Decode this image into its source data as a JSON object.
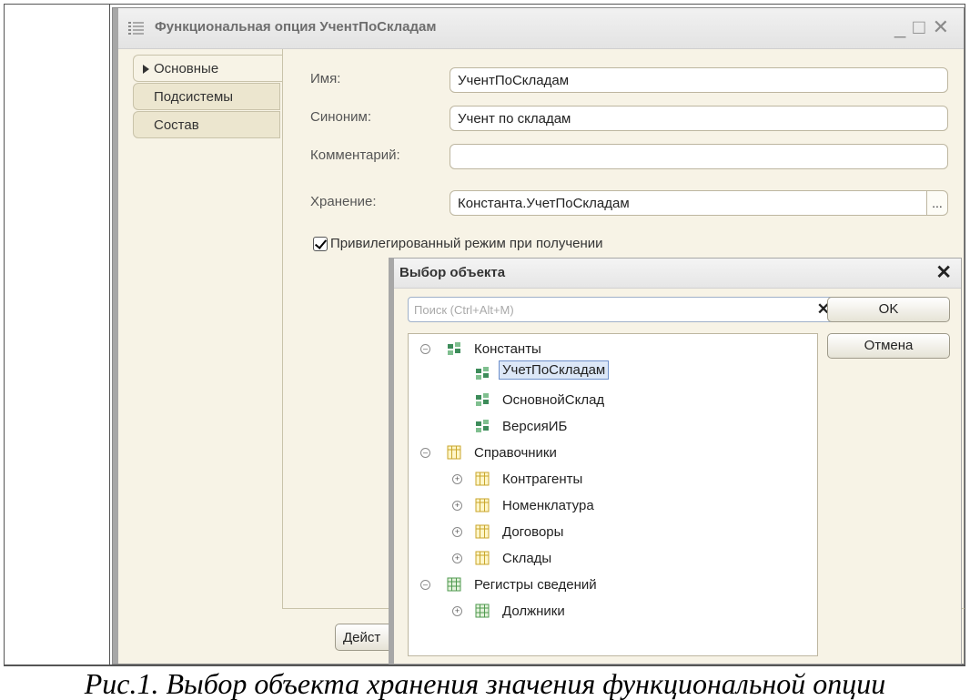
{
  "window": {
    "title": "Функциональная опция УчентПоСкладам",
    "controls": [
      "_",
      "□",
      "✕"
    ]
  },
  "tabs": [
    {
      "label": "Основные",
      "active": true
    },
    {
      "label": "Подсистемы",
      "active": false
    },
    {
      "label": "Состав",
      "active": false
    }
  ],
  "form": {
    "name_label": "Имя:",
    "name_value": "УчентПоСкладам",
    "synonym_label": "Синоним:",
    "synonym_value": "Учент по складам",
    "comment_label": "Комментарий:",
    "comment_value": "",
    "storage_label": "Хранение:",
    "storage_value": "Константа.УчетПоСкладам",
    "storage_button": "...",
    "privileged_label": "Привилегированный режим при получении",
    "privileged_checked": true,
    "actions_button": "Дейст"
  },
  "dialog": {
    "title": "Выбор объекта",
    "close": "✕",
    "search_placeholder": "Поиск (Ctrl+Alt+M)",
    "search_clear": "✕",
    "ok_label": "OK",
    "cancel_label": "Отмена",
    "tree": [
      {
        "label": "Константы",
        "level": 0,
        "expander": "minus",
        "icon": "constant-icon"
      },
      {
        "label": "УчетПоСкладам",
        "level": 1,
        "expander": "none",
        "icon": "constant-icon",
        "selected": true
      },
      {
        "label": "ОсновнойСклад",
        "level": 1,
        "expander": "none",
        "icon": "constant-icon"
      },
      {
        "label": "ВерсияИБ",
        "level": 1,
        "expander": "none",
        "icon": "constant-icon"
      },
      {
        "label": "Справочники",
        "level": 0,
        "expander": "minus",
        "icon": "catalog-icon"
      },
      {
        "label": "Контрагенты",
        "level": 1,
        "expander": "plus",
        "icon": "catalog-icon"
      },
      {
        "label": "Номенклатура",
        "level": 1,
        "expander": "plus",
        "icon": "catalog-icon"
      },
      {
        "label": "Договоры",
        "level": 1,
        "expander": "plus",
        "icon": "catalog-icon"
      },
      {
        "label": "Склады",
        "level": 1,
        "expander": "plus",
        "icon": "catalog-icon"
      },
      {
        "label": "Регистры сведений",
        "level": 0,
        "expander": "minus",
        "icon": "register-icon"
      },
      {
        "label": "Должники",
        "level": 1,
        "expander": "plus",
        "icon": "register-icon"
      }
    ]
  },
  "caption": "Рис.1. Выбор объекта хранения значения функциональной опции",
  "colors": {
    "panel_bg": "#f7f3e6",
    "tab_bg": "#ece6cf",
    "selection": "#dce7f7",
    "catalog_icon": "#e6c84f",
    "constant_icon": "#3d8c5a",
    "register_icon": "#5aa05a"
  }
}
